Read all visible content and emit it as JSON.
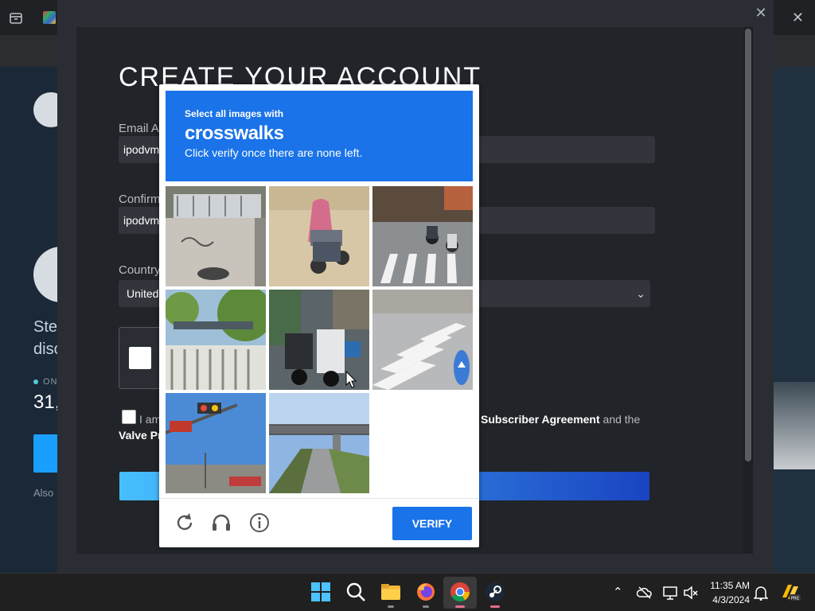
{
  "dialog": {
    "title": "CREATE YOUR ACCOUNT",
    "email_label": "Email Ac",
    "email_value": "ipodvm",
    "confirm_label": "Confirm",
    "confirm_value": "ipodvm",
    "country_label": "Country",
    "country_value": "United",
    "agree_left": "I am",
    "agree_right_link": "Subscriber Agreement",
    "agree_right_tail": "and the",
    "valve_link": "Valve Pr"
  },
  "background": {
    "side_text_1": "Ste",
    "side_text_2": "disc",
    "online_label": "ON",
    "online_count": "31,",
    "also_text": "Also"
  },
  "captcha": {
    "line1": "Select all images with",
    "keyword": "crosswalks",
    "line3": "Click verify once there are none left.",
    "verify_label": "VERIFY",
    "tiles": [
      "tile-wall-graffiti",
      "tile-scooter-rider",
      "tile-crosswalk-traffic",
      "tile-bus-stop-trees",
      "tile-parked-scooters",
      "tile-crosswalk-arrow",
      "tile-traffic-light",
      "tile-overpass-road"
    ]
  },
  "taskbar": {
    "time": "11:35 AM",
    "date": "4/3/2024",
    "apps": [
      "start",
      "search",
      "file-explorer",
      "firefox",
      "chrome",
      "steam"
    ]
  },
  "colors": {
    "accent": "#1a73e8",
    "dialog_bg": "#212429",
    "steam_bg": "#1b2838"
  }
}
